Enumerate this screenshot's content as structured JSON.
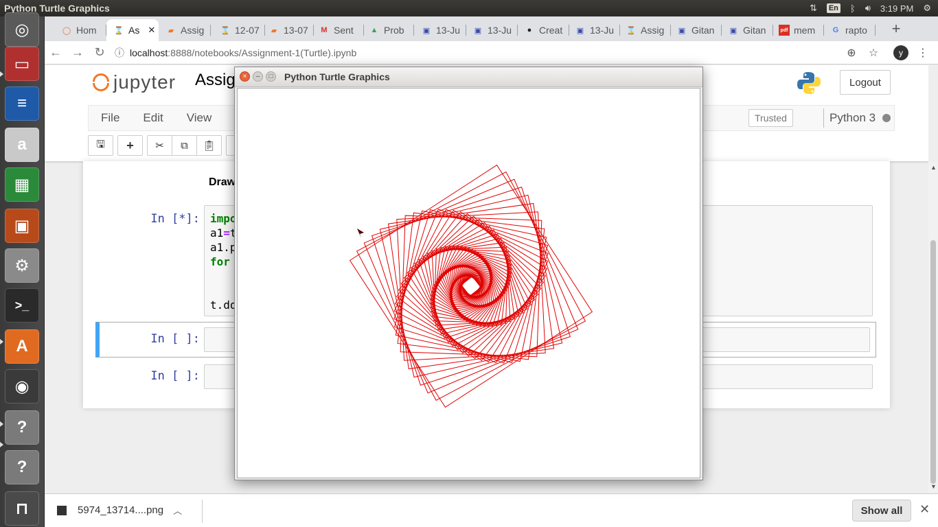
{
  "system": {
    "window_title": "Python Turtle Graphics",
    "keyboard_layout": "En",
    "clock": "3:19 PM"
  },
  "launcher": {
    "items": [
      {
        "name": "dash",
        "glyph": "◎",
        "color": "#5a5a5a"
      },
      {
        "name": "files",
        "glyph": "▭",
        "color": "#b03030"
      },
      {
        "name": "writer",
        "glyph": "≡",
        "color": "#1f5aa8"
      },
      {
        "name": "amazon",
        "glyph": "a",
        "color": "#c9c9c9"
      },
      {
        "name": "calc",
        "glyph": "▦",
        "color": "#2a8a3a"
      },
      {
        "name": "impress",
        "glyph": "▣",
        "color": "#b84a1a"
      },
      {
        "name": "settings",
        "glyph": "⚙",
        "color": "#8a8a8a"
      },
      {
        "name": "terminal",
        "glyph": ">_",
        "color": "#2a2a2a"
      },
      {
        "name": "software",
        "glyph": "A",
        "color": "#e06a20"
      },
      {
        "name": "chrome",
        "glyph": "◉",
        "color": "#3a3a3a"
      },
      {
        "name": "unknown-1",
        "glyph": "?",
        "color": "#7a7a7a"
      },
      {
        "name": "unknown-2",
        "glyph": "?",
        "color": "#7a7a7a"
      },
      {
        "name": "trash",
        "glyph": "⊓",
        "color": "#4a4a4a"
      }
    ]
  },
  "browser": {
    "tabs": [
      {
        "label": "Hom",
        "fav": "◯",
        "favcolor": "#f37726"
      },
      {
        "label": "As",
        "fav": "⌛",
        "favcolor": "#f37726",
        "active": true
      },
      {
        "label": "Assig",
        "fav": "▰",
        "favcolor": "#f37726"
      },
      {
        "label": "12-07",
        "fav": "⌛",
        "favcolor": "#f37726"
      },
      {
        "label": "13-07",
        "fav": "▰",
        "favcolor": "#f37726"
      },
      {
        "label": "Sent",
        "fav": "M",
        "favcolor": "#d93025"
      },
      {
        "label": "Prob",
        "fav": "▲",
        "favcolor": "#34a853"
      },
      {
        "label": "13-Ju",
        "fav": "▣",
        "favcolor": "#3949ab"
      },
      {
        "label": "13-Ju",
        "fav": "▣",
        "favcolor": "#3949ab"
      },
      {
        "label": "Creat",
        "fav": "●",
        "favcolor": "#222222"
      },
      {
        "label": "13-Ju",
        "fav": "▣",
        "favcolor": "#3949ab"
      },
      {
        "label": "Assig",
        "fav": "⌛",
        "favcolor": "#f37726"
      },
      {
        "label": "Gitan",
        "fav": "▣",
        "favcolor": "#3949ab"
      },
      {
        "label": "Gitan",
        "fav": "▣",
        "favcolor": "#3949ab"
      },
      {
        "label": "mem",
        "fav": "pdf",
        "favcolor": "#d93025"
      },
      {
        "label": "rapto",
        "fav": "G",
        "favcolor": "#4285f4"
      }
    ],
    "new_tab": "+",
    "url_host": "localhost",
    "url_path": ":8888/notebooks/Assignment-1(Turtle).ipynb",
    "profile_initial": "y"
  },
  "jupyter": {
    "logo_text": "jupyter",
    "notebook_name": "Assig",
    "logout_label": "Logout",
    "menu": [
      "File",
      "Edit",
      "View"
    ],
    "trusted_label": "Trusted",
    "kernel_name": "Python 3",
    "markdown_text": "Draw",
    "cells": [
      {
        "prompt": "In [*]:",
        "lines": [
          "impo",
          "a1=t",
          "a1.p",
          "for",
          "",
          "",
          "t.do"
        ]
      },
      {
        "prompt": "In [ ]:",
        "lines": [
          ""
        ]
      },
      {
        "prompt": "In [ ]:",
        "lines": [
          ""
        ]
      }
    ]
  },
  "downloads": {
    "filename": "5974_13714....png",
    "show_all_label": "Show all"
  },
  "turtle_window": {
    "title": "Python Turtle Graphics",
    "pen_color": "#e00000",
    "squares": 72,
    "turn_deg": 5,
    "shrink": 0.965
  }
}
